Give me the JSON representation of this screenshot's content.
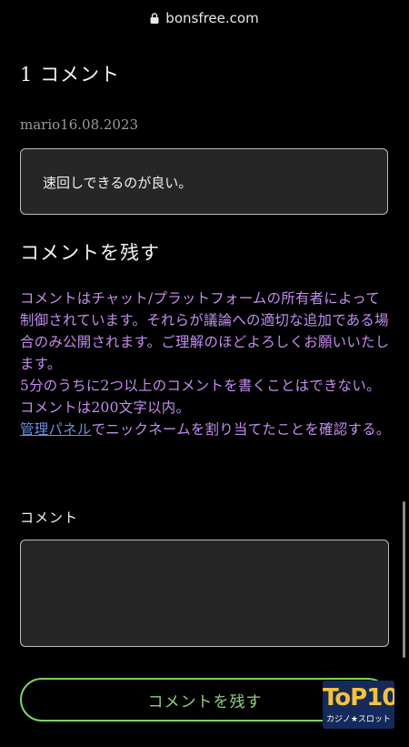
{
  "browser": {
    "url": "bonsfree.com"
  },
  "comments": {
    "count_title": "1 コメント",
    "items": [
      {
        "meta": "mario16.08.2023",
        "text": "速回しできるのが良い。"
      }
    ]
  },
  "leave_comment": {
    "title": "コメントを残す",
    "notice_lines": [
      "コメントはチャット/プラットフォームの所有者によって制御されています。それらが議論への適切な追加である場合のみ公開されます。ご理解のほどよろしくお願いいたします。",
      "5分のうちに2つ以上のコメントを書くことはできない。",
      "コメントは200文字以内。"
    ],
    "admin_link": "管理パネル",
    "admin_suffix": "でニックネームを割り当てたことを確認する。",
    "field_label": "コメント",
    "field_value": "",
    "submit_label": "コメントを残す"
  },
  "badge": {
    "logo": "ToP10",
    "subtitle": "カジノ★スロット"
  },
  "colors": {
    "accent_green": "#7cd35a",
    "notice_purple": "#c48cf0",
    "link_blue": "#6b8fe0"
  }
}
